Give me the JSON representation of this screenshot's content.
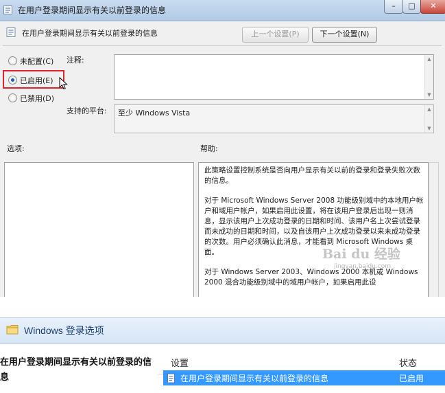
{
  "dialog": {
    "title": "在用户登录期间显示有关以前登录的信息",
    "window_buttons": [
      "–",
      "□",
      "✕"
    ],
    "header_title": "在用户登录期间显示有关以前登录的信息",
    "prev_button": "上一个设置(P)",
    "next_button": "下一个设置(N)",
    "radios": [
      {
        "label": "未配置(C)",
        "selected": false
      },
      {
        "label": "已启用(E)",
        "selected": true
      },
      {
        "label": "已禁用(D)",
        "selected": false
      }
    ],
    "comment_label": "注释:",
    "comment_value": "",
    "platform_label": "支持的平台:",
    "platform_value": "至少 Windows Vista",
    "options_label": "选项:",
    "help_label": "帮助:",
    "help_paragraphs": [
      "此策略设置控制系统是否向用户显示有关以前的登录和登录失败次数的信息。",
      "对于 Microsoft Windows Server 2008 功能级别域中的本地用户帐户和域用户帐户，如果启用此设置，将在该用户登录后出现一则消息，显示该用户上次成功登录的日期和时间、该用户名上次尝试登录而未成功的日期和时间，以及自该用户上次成功登录以来未成功登录的次数。用户必须确认此消息，才能看到 Microsoft Windows 桌面。",
      "对于 Windows Server 2003、Windows 2000 本机或 Windows 2000 混合功能级别域中的域用户帐户，如果启用此设"
    ],
    "watermark": "Bai du 经验",
    "watermark_url": "jingyan.baidu.com"
  },
  "panel": {
    "title": "Windows 登录选项",
    "policy_description": "在用户登录期间显示有关以前登录的信息",
    "columns": {
      "setting": "设置",
      "state": "状态"
    },
    "rows": [
      {
        "name": "在用户登录期间显示有关以前登录的信息",
        "state": "已启用",
        "selected": true
      }
    ]
  },
  "colors": {
    "selection": "#3399ff",
    "highlight_box": "#e0242c",
    "title_bar": "#c8dbf0"
  }
}
